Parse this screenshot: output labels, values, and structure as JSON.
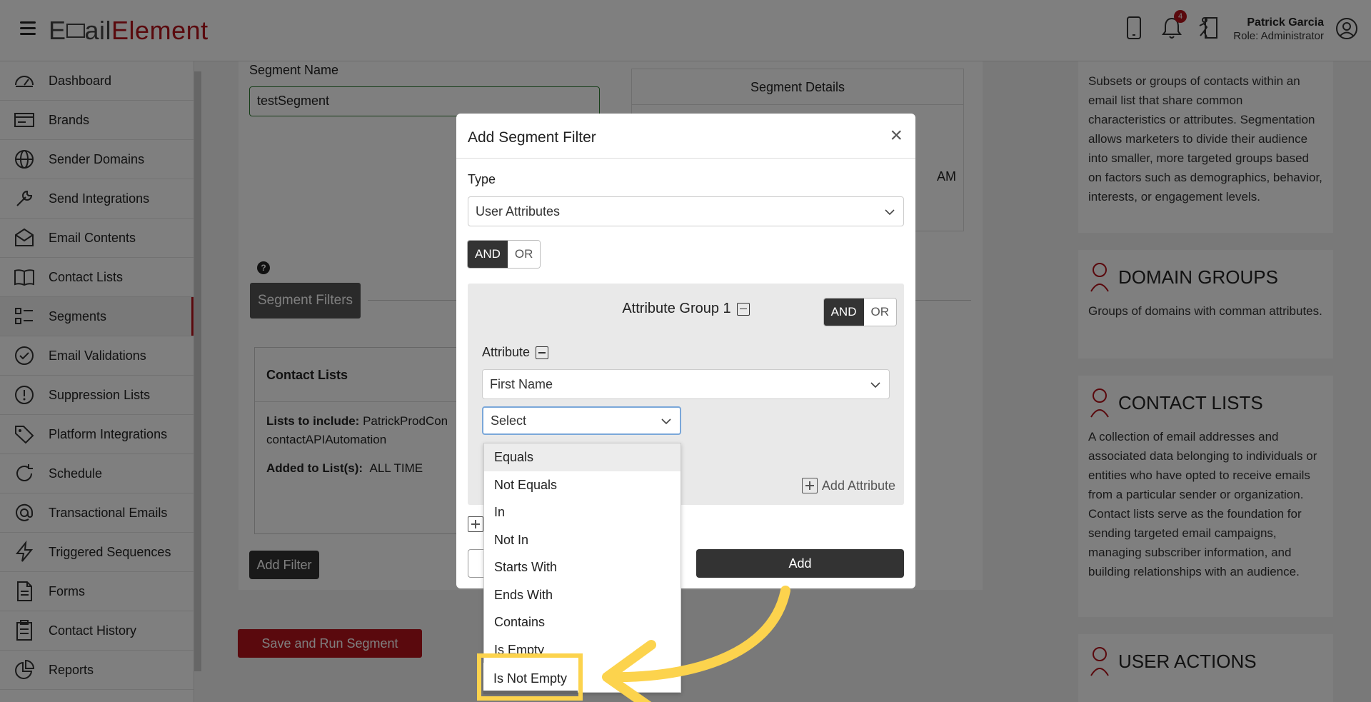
{
  "header": {
    "logo_part1": "E",
    "logo_part2": "ail",
    "logo_part3": "Element",
    "notification_count": "4",
    "user_name": "Patrick Garcia",
    "user_role": "Role: Administrator"
  },
  "sidebar": {
    "items": [
      {
        "label": "Dashboard",
        "icon": "dashboard-icon"
      },
      {
        "label": "Brands",
        "icon": "brands-icon"
      },
      {
        "label": "Sender Domains",
        "icon": "globe-icon"
      },
      {
        "label": "Send Integrations",
        "icon": "wrench-icon"
      },
      {
        "label": "Email Contents",
        "icon": "envelope-icon"
      },
      {
        "label": "Contact Lists",
        "icon": "book-icon"
      },
      {
        "label": "Segments",
        "icon": "segments-icon"
      },
      {
        "label": "Email Validations",
        "icon": "check-circle-icon"
      },
      {
        "label": "Suppression Lists",
        "icon": "exclamation-icon"
      },
      {
        "label": "Platform Integrations",
        "icon": "tag-icon"
      },
      {
        "label": "Schedule",
        "icon": "refresh-icon"
      },
      {
        "label": "Transactional Emails",
        "icon": "at-icon"
      },
      {
        "label": "Triggered Sequences",
        "icon": "bolt-icon"
      },
      {
        "label": "Forms",
        "icon": "document-icon"
      },
      {
        "label": "Contact History",
        "icon": "clipboard-icon"
      },
      {
        "label": "Reports",
        "icon": "pie-chart-icon"
      }
    ],
    "active_label": "Segments"
  },
  "main": {
    "segment_name_label": "Segment Name",
    "segment_name_value": "testSegment",
    "segment_details_title": "Segment Details",
    "segment_details_partial": "AM",
    "help_icon_text": "?",
    "segment_filters_tab": "Segment Filters",
    "contact_lists_title": "Contact Lists",
    "lists_to_include_label": "Lists to include:",
    "lists_to_include_value": "PatrickProdCon",
    "lists_to_include_value2": "contactAPIAutomation",
    "added_to_list_label": "Added to List(s):",
    "added_to_list_value": "ALL TIME",
    "add_filter_button": "Add Filter",
    "save_run_button": "Save and Run Segment"
  },
  "info_panel": {
    "segments_text": "Subsets or groups of contacts within an email list that share common characteristics or attributes. Segmentation allows marketers to divide their audience into smaller, more targeted groups based on factors such as demographics, behavior, interests, or engagement levels.",
    "domain_groups_title": "DOMAIN GROUPS",
    "domain_groups_text": "Groups of domains with comman attributes.",
    "contact_lists_title": "CONTACT LISTS",
    "contact_lists_text": "A collection of email addresses and associated data belonging to individuals or entities who have opted to receive emails from a particular sender or organization. Contact lists serve as the foundation for sending targeted email campaigns, managing subscriber information, and building relationships with an audience.",
    "user_actions_title": "USER ACTIONS"
  },
  "modal": {
    "title": "Add Segment Filter",
    "close_glyph": "×",
    "type_label": "Type",
    "type_value": "User Attributes",
    "and_label": "AND",
    "or_label": "OR",
    "attribute_group_title": "Attribute Group 1",
    "attribute_label": "Attribute",
    "attribute_value": "First Name",
    "operator_placeholder": "Select",
    "add_attribute": "Add Attribute",
    "add_button": "Add"
  },
  "dropdown": {
    "options": [
      "Equals",
      "Not Equals",
      "In",
      "Not In",
      "Starts With",
      "Ends With",
      "Contains",
      "Is Empty"
    ],
    "highlighted_option": "Is Not Empty"
  },
  "colors": {
    "brand_red": "#b4121b",
    "highlight_yellow": "#fcd34d"
  }
}
